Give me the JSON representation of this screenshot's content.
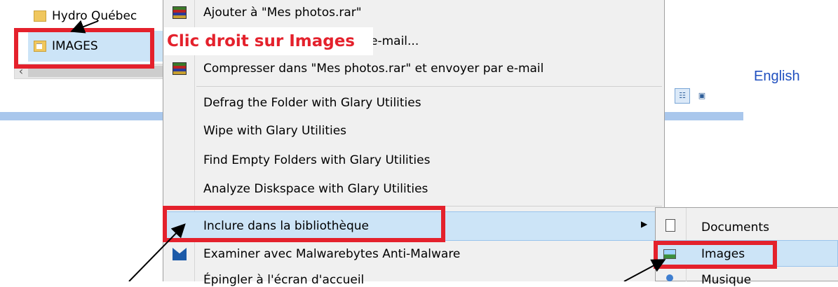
{
  "explorer": {
    "tree": {
      "hydro_label": "Hydro Québec",
      "images_label": "IMAGES"
    },
    "language_link": "English"
  },
  "context_menu": {
    "items": [
      {
        "label": "Ajouter à \"Mes photos.rar\"",
        "icon": "winrar-icon"
      },
      {
        "label": "Compresser et envoyer par e-mail...",
        "icon": "winrar-icon"
      },
      {
        "label": "Compresser dans \"Mes photos.rar\" et envoyer par e-mail",
        "icon": "winrar-icon"
      },
      {
        "label": "Defrag the Folder with Glary Utilities"
      },
      {
        "label": "Wipe with Glary Utilities"
      },
      {
        "label": "Find Empty Folders with Glary Utilities"
      },
      {
        "label": "Analyze Diskspace with Glary Utilities"
      },
      {
        "label": "Inclure dans la bibliothèque",
        "has_submenu": true
      },
      {
        "label": "Examiner avec Malwarebytes Anti-Malware",
        "icon": "malwarebytes-icon"
      },
      {
        "label": "Épingler à l'écran d'accueil"
      }
    ],
    "visible_partial_label": "r e-mail..."
  },
  "submenu": {
    "items": [
      {
        "label": "Documents",
        "icon": "documents-library-icon"
      },
      {
        "label": "Images",
        "icon": "images-library-icon"
      },
      {
        "label": "Musique",
        "icon": "music-library-icon"
      }
    ]
  },
  "annotation": {
    "callout_text": "Clic droit sur Images",
    "box_color": "#e4212c"
  },
  "colors": {
    "highlight": "#cce4f7",
    "link_blue": "#1f4fbf",
    "annotation_red": "#e4212c"
  }
}
